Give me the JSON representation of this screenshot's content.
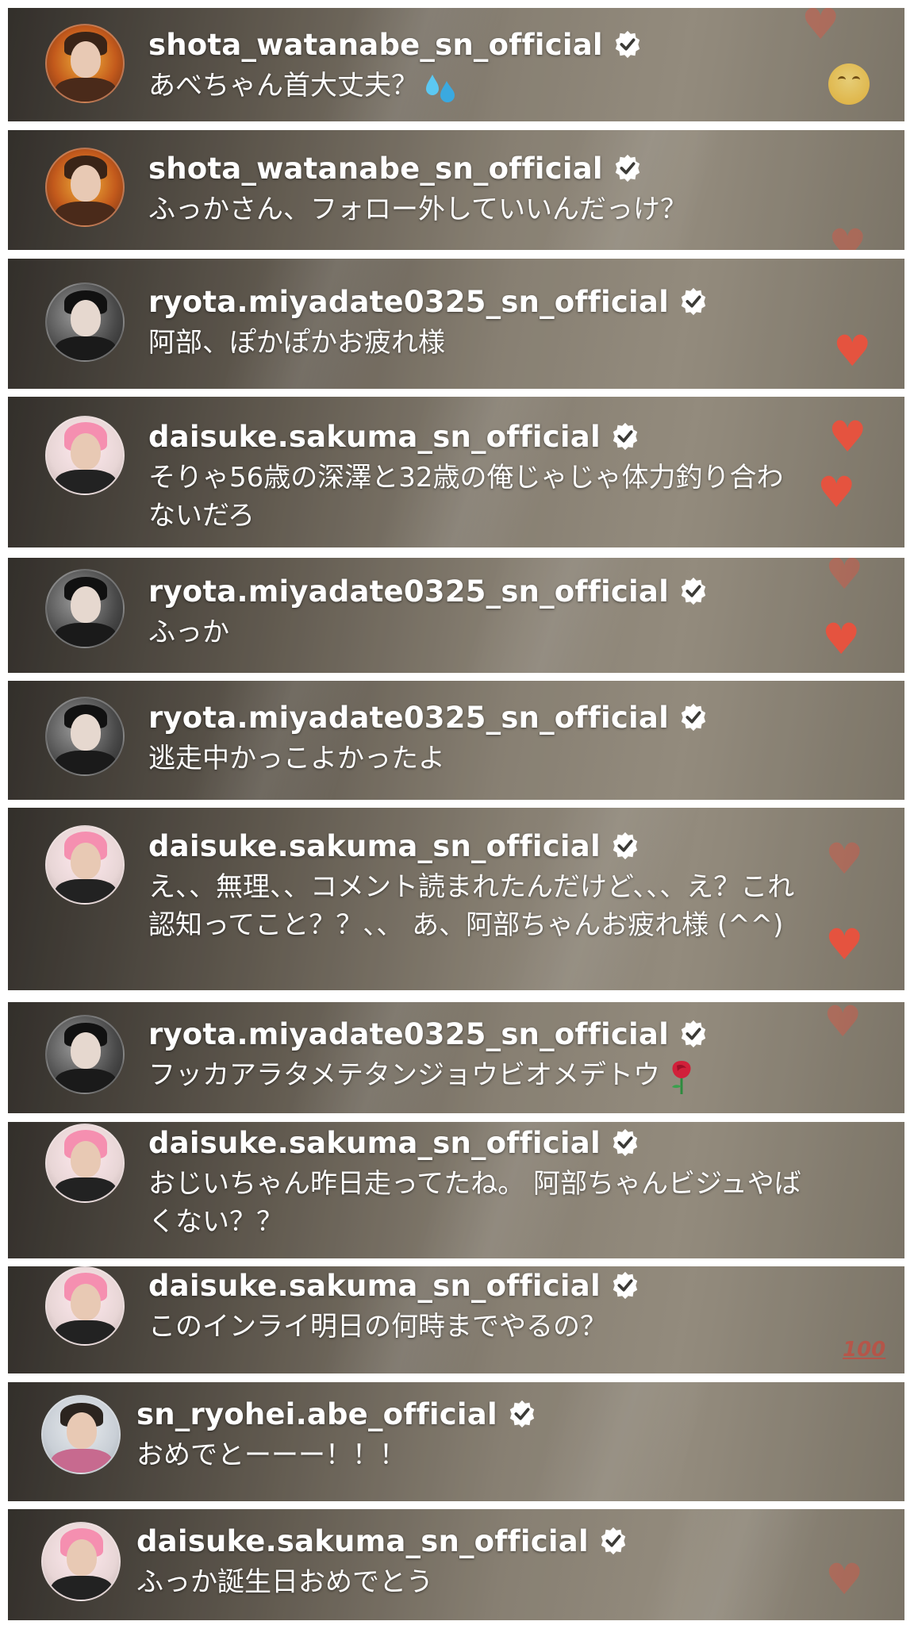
{
  "colors": {
    "text": "#ffffff",
    "verified_badge_fill": "#ffffff",
    "verified_badge_check": "#3b3a36",
    "heart": "#e5533f",
    "page_background": "#ffffff"
  },
  "icons": {
    "verified": "verified-badge-icon",
    "reaction": "heart-icon",
    "laughing": "laughing-face-emoji-icon",
    "sweat": "sweat-droplets-emoji-icon",
    "rose": "rose-emoji-icon",
    "hundred": "hundred-points-emoji-icon"
  },
  "comments": [
    {
      "username": "shota_watanabe_sn_official",
      "text": "あべちゃん首大丈夫？",
      "avatar": "avatar-watanabe",
      "trailing_emoji": "sweat-droplets-emoji-icon"
    },
    {
      "username": "shota_watanabe_sn_official",
      "text": "ふっかさん、フォロー外していいんだっけ？",
      "avatar": "avatar-watanabe"
    },
    {
      "username": "ryota.miyadate0325_sn_official",
      "text": "阿部、ぽかぽかお疲れ様",
      "avatar": "avatar-miyadate"
    },
    {
      "username": "daisuke.sakuma_sn_official",
      "text": "そりゃ56歳の深澤と32歳の俺じゃじゃ体力釣り合わないだろ",
      "avatar": "avatar-sakuma"
    },
    {
      "username": "ryota.miyadate0325_sn_official",
      "text": "ふっか",
      "avatar": "avatar-miyadate"
    },
    {
      "username": "ryota.miyadate0325_sn_official",
      "text": "逃走中かっこよかったよ",
      "avatar": "avatar-miyadate"
    },
    {
      "username": "daisuke.sakuma_sn_official",
      "text": "え、、無理、、コメント読まれたんだけど、、、え？これ認知ってこと？？、、 あ、阿部ちゃんお疲れ様 (^^)",
      "avatar": "avatar-sakuma"
    },
    {
      "username": "ryota.miyadate0325_sn_official",
      "text": "フッカアラタメテタンジョウビオメデトウ",
      "avatar": "avatar-miyadate",
      "trailing_emoji": "rose-emoji-icon"
    },
    {
      "username": "daisuke.sakuma_sn_official",
      "text": "おじいちゃん昨日走ってたね。 阿部ちゃんビジュやばくない？？",
      "avatar": "avatar-sakuma"
    },
    {
      "username": "daisuke.sakuma_sn_official",
      "text": "このインライ明日の何時までやるの？",
      "avatar": "avatar-sakuma"
    },
    {
      "username": "sn_ryohei.abe_official",
      "text": "おめでとーーー！！！",
      "avatar": "avatar-abe"
    },
    {
      "username": "daisuke.sakuma_sn_official",
      "text": "ふっか誕生日おめでとう",
      "avatar": "avatar-sakuma"
    }
  ]
}
